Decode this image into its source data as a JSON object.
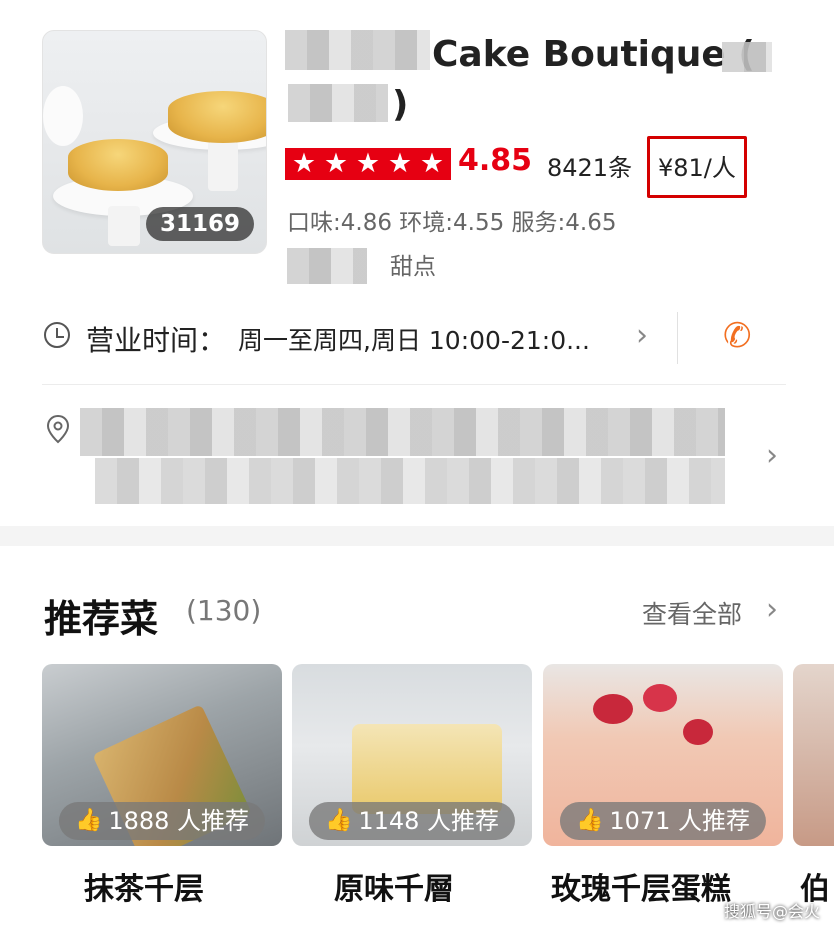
{
  "shop": {
    "name_part1": "Cake Boutique (",
    "name_part2": ")",
    "photo_count": "31169",
    "rating": "4.85",
    "review_count": "8421条",
    "price": "¥81/人",
    "scores": "口味:4.86 环境:4.55 服务:4.65",
    "category": "甜点"
  },
  "hours": {
    "label": "营业时间：",
    "value": "周一至周四,周日 10:00-21:0..."
  },
  "recommended": {
    "title": "推荐菜",
    "count": "(130)",
    "view_all": "查看全部",
    "dishes": [
      {
        "name": "抹茶千层",
        "likes": "1888 人推荐"
      },
      {
        "name": "原味千層",
        "likes": "1148 人推荐"
      },
      {
        "name": "玫瑰千层蛋糕",
        "likes": "1071 人推荐"
      },
      {
        "name": "伯"
      }
    ]
  },
  "watermark": "搜狐号@会火",
  "colors": {
    "brand_red": "#e60012",
    "phone_orange": "#f26f21"
  }
}
